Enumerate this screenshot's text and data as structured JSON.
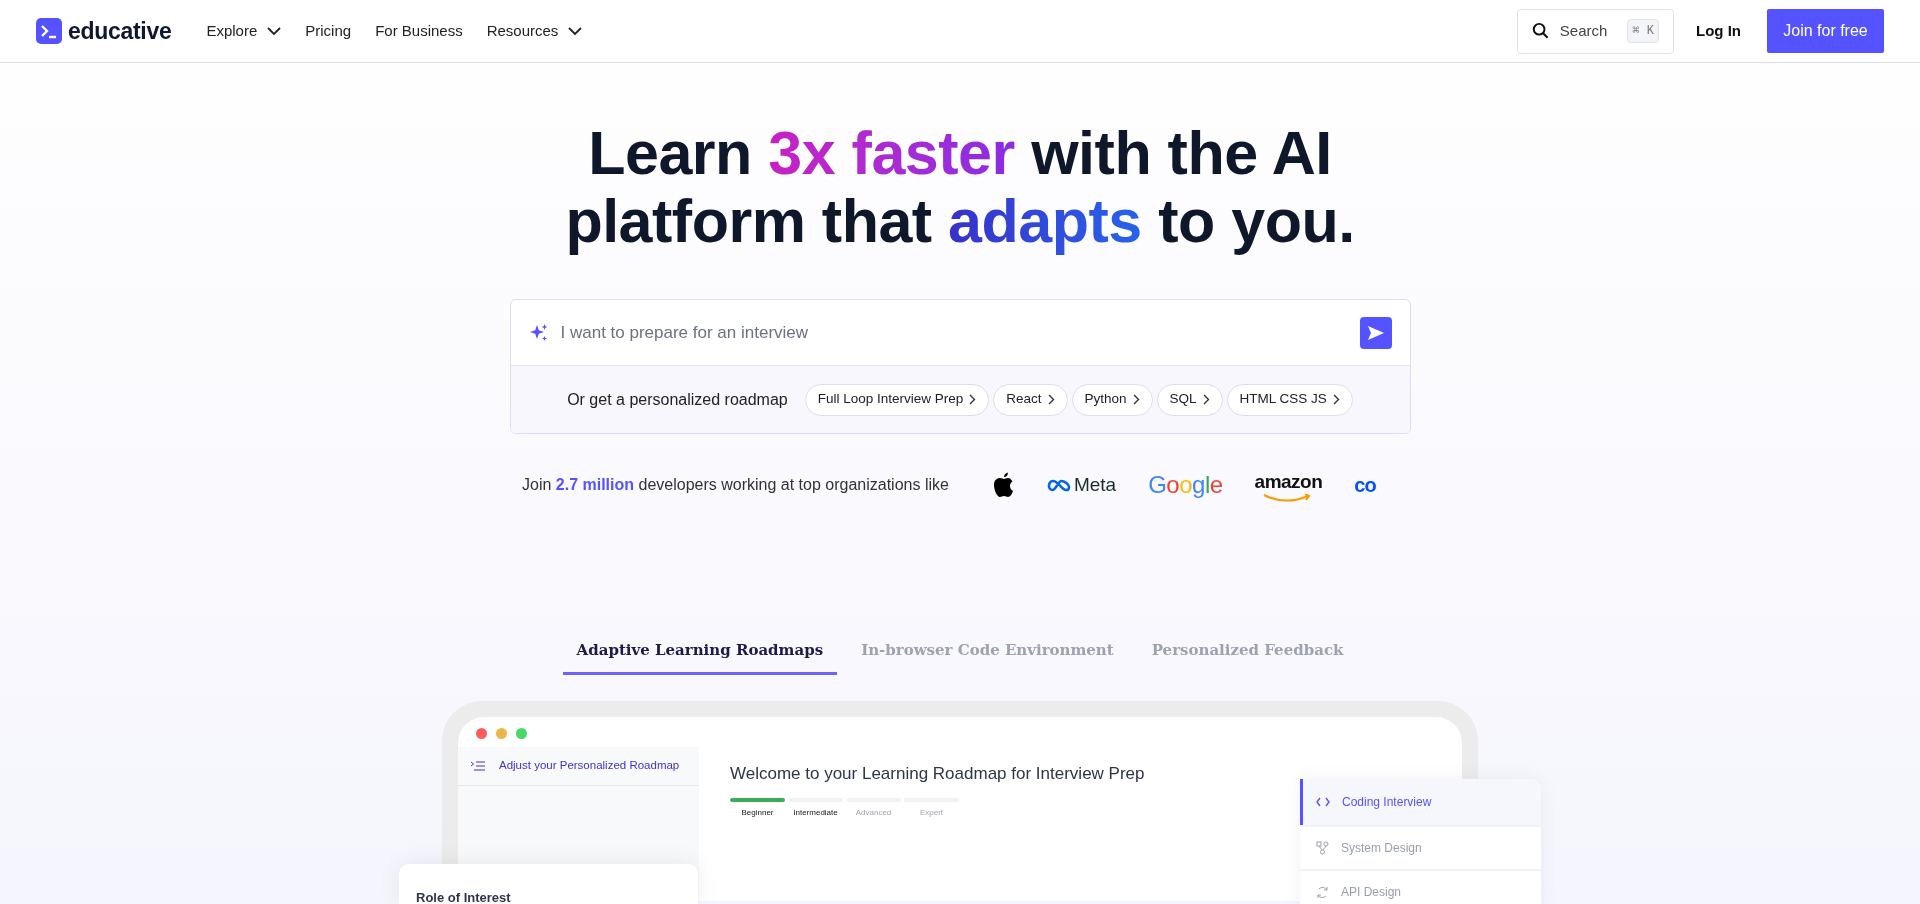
{
  "header": {
    "logo": "educative",
    "nav": [
      {
        "label": "Explore",
        "dropdown": true
      },
      {
        "label": "Pricing",
        "dropdown": false
      },
      {
        "label": "For Business",
        "dropdown": false
      },
      {
        "label": "Resources",
        "dropdown": true
      }
    ],
    "search": {
      "label": "Search",
      "shortcut": "⌘ K"
    },
    "login": "Log In",
    "join": "Join for free"
  },
  "hero": {
    "headline": [
      {
        "text": "Learn ",
        "kind": "plain"
      },
      {
        "text": "3x faster",
        "kind": "purple"
      },
      {
        "text": " with the AI platform that ",
        "kind": "plain"
      },
      {
        "text": "adapts",
        "kind": "blue"
      },
      {
        "text": " to you.",
        "kind": "plain"
      }
    ],
    "prompt": {
      "placeholder": "I want to prepare for an interview"
    },
    "roadmap_label": "Or get a personalized roadmap",
    "chips": [
      "Full Loop Interview Prep",
      "React",
      "Python",
      "SQL",
      "HTML CSS JS"
    ],
    "social_proof": "Join **2.7 million** developers working at top organizations like",
    "logos": [
      {
        "kind": "apple"
      },
      {
        "kind": "meta",
        "text": "Meta"
      },
      {
        "kind": "google",
        "text": "Google"
      },
      {
        "kind": "amazon",
        "text": "amazon"
      },
      {
        "kind": "cut",
        "text": "co"
      }
    ]
  },
  "feature_tabs": [
    {
      "label": "Adaptive Learning Roadmaps",
      "selected": true
    },
    {
      "label": "In-browser Code Environment",
      "selected": false
    },
    {
      "label": "Personalized Feedback",
      "selected": false
    }
  ],
  "mockup": {
    "sidebar_header": "Adjust your Personalized Roadmap",
    "title": "Welcome to your Learning Roadmap for Interview Prep",
    "levels": [
      {
        "label": "Beginner",
        "completed": true,
        "reached": true
      },
      {
        "label": "Intermediate",
        "completed": false,
        "reached": true
      },
      {
        "label": "Advanced",
        "completed": false,
        "reached": false
      },
      {
        "label": "Expert",
        "completed": false,
        "reached": false
      }
    ],
    "role_card": {
      "title": "Role of Interest"
    },
    "tracks": [
      {
        "label": "Coding Interview",
        "kind": "code",
        "selected": true
      },
      {
        "label": "System Design",
        "kind": "nodes",
        "selected": false
      },
      {
        "label": "API Design",
        "kind": "api",
        "selected": false
      }
    ]
  }
}
